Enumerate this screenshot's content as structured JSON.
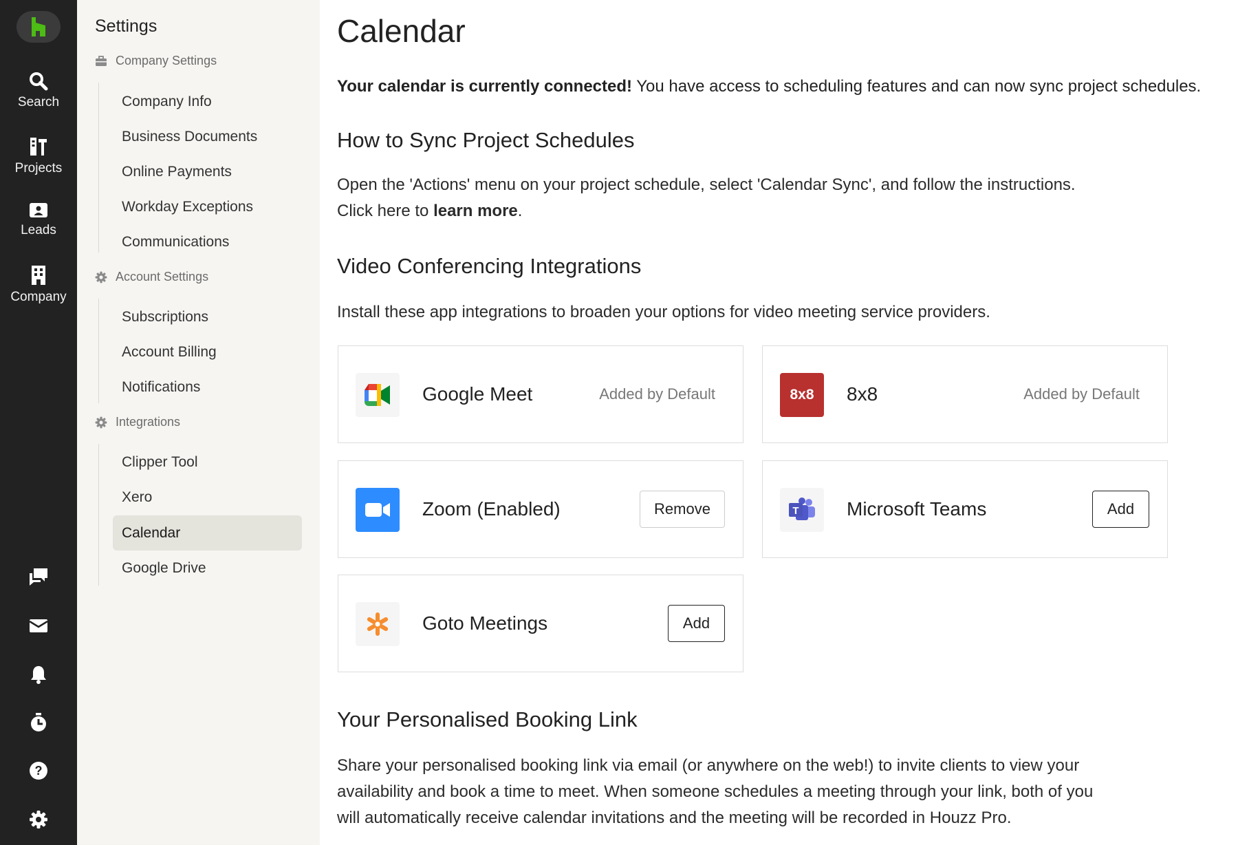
{
  "colors": {
    "rail_bg": "#222222",
    "sidebar_bg": "#f6f5f2",
    "active_nav_bg": "#e4e3dc",
    "houzz_green": "#4dbc15",
    "eight_by_eight_red": "#b8312f",
    "zoom_blue": "#2d8cff",
    "teams_purple": "#5059c9",
    "goto_orange": "#f68d2e"
  },
  "rail": {
    "items": [
      {
        "label": "Search",
        "icon": "search-icon"
      },
      {
        "label": "Projects",
        "icon": "projects-icon"
      },
      {
        "label": "Leads",
        "icon": "leads-icon"
      },
      {
        "label": "Company",
        "icon": "company-icon"
      }
    ],
    "bottom_icons": [
      "chat-icon",
      "inbox-icon",
      "bell-icon",
      "timer-icon",
      "help-icon",
      "gear-icon"
    ]
  },
  "sidebar": {
    "title": "Settings",
    "groups": [
      {
        "label": "Company Settings",
        "icon": "briefcase-icon",
        "items": [
          "Company Info",
          "Business Documents",
          "Online Payments",
          "Workday Exceptions",
          "Communications"
        ]
      },
      {
        "label": "Account Settings",
        "icon": "gear-icon",
        "items": [
          "Subscriptions",
          "Account Billing",
          "Notifications"
        ]
      },
      {
        "label": "Integrations",
        "icon": "gear-icon",
        "items": [
          "Clipper Tool",
          "Xero",
          "Calendar",
          "Google Drive"
        ]
      }
    ],
    "active_item": "Calendar"
  },
  "main": {
    "title": "Calendar",
    "status_bold": "Your calendar is currently connected!",
    "status_rest": " You have access to scheduling features and can now sync project schedules.",
    "sync": {
      "heading": "How to Sync Project Schedules",
      "line1": "Open the 'Actions' menu on your project schedule, select 'Calendar Sync', and follow the instructions.",
      "line2_prefix": "Click here to ",
      "line2_link": "learn more",
      "line2_suffix": "."
    },
    "video": {
      "heading": "Video Conferencing Integrations",
      "description": "Install these app integrations to broaden your options for video meeting service providers.",
      "integrations": [
        {
          "name": "Google Meet",
          "status": "Added by Default",
          "icon": "google-meet-icon"
        },
        {
          "name": "8x8",
          "status": "Added by Default",
          "icon": "eight-by-eight-icon",
          "logo_text": "8x8"
        },
        {
          "name": "Zoom (Enabled)",
          "action": "Remove",
          "icon": "zoom-icon"
        },
        {
          "name": "Microsoft Teams",
          "action": "Add",
          "icon": "microsoft-teams-icon"
        },
        {
          "name": "Goto Meetings",
          "action": "Add",
          "icon": "goto-meetings-icon"
        }
      ]
    },
    "booking": {
      "heading": "Your Personalised Booking Link",
      "lines": [
        "Share your personalised booking link via email (or anywhere on the web!) to invite clients to view your",
        "availability and book a time to meet. When someone schedules a meeting through your link, both of you",
        "will automatically receive calendar invitations and the meeting will be recorded in Houzz Pro."
      ]
    }
  }
}
